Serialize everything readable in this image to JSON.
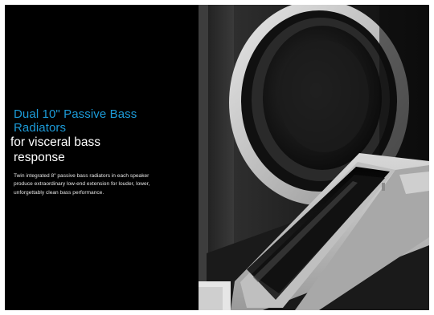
{
  "feature": {
    "heading_accent_line1": "Dual 10\" Passive Bass",
    "heading_accent_line2": "Radiators",
    "heading_main_line1": "for visceral bass",
    "heading_main_line2": "response",
    "body": "Twin integrated 8\" passive bass radiators in each speaker produce extraordinary low-end extension for louder, lower, unforgettably clean bass performance."
  },
  "colors": {
    "background": "#000000",
    "accent": "#1c9bd8",
    "text": "#ffffff"
  },
  "image": {
    "subject": "speaker-passive-bass-radiator-closeup"
  }
}
